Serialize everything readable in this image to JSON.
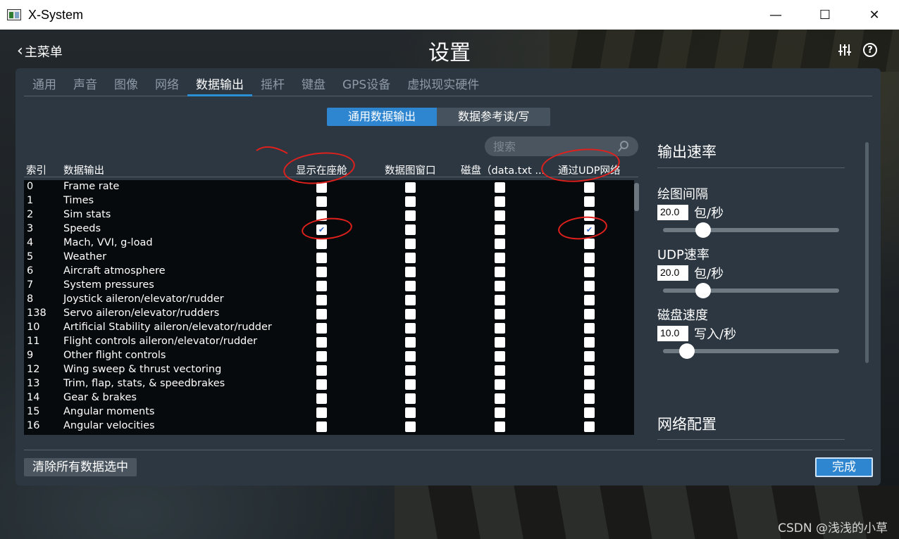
{
  "window": {
    "title": "X-System",
    "minimize": "—",
    "maximize": "☐",
    "close": "✕"
  },
  "header": {
    "back_label": "主菜单",
    "title": "设置"
  },
  "tabs": [
    "通用",
    "声音",
    "图像",
    "网络",
    "数据输出",
    "摇杆",
    "键盘",
    "GPS设备",
    "虚拟现实硬件"
  ],
  "active_tab": "数据输出",
  "segments": [
    "通用数据输出",
    "数据参考读/写"
  ],
  "search": {
    "placeholder": "搜索"
  },
  "columns": {
    "index": "索引",
    "output": "数据输出",
    "cockpit": "显示在座舱",
    "graph": "数据图窗口",
    "disk": "磁盘（data.txt ...",
    "udp": "通过UDP网络"
  },
  "rows": [
    {
      "idx": "0",
      "name": "Frame rate",
      "cockpit": false,
      "graph": false,
      "disk": false,
      "udp": false
    },
    {
      "idx": "1",
      "name": "Times",
      "cockpit": false,
      "graph": false,
      "disk": false,
      "udp": false
    },
    {
      "idx": "2",
      "name": "Sim stats",
      "cockpit": false,
      "graph": false,
      "disk": false,
      "udp": false
    },
    {
      "idx": "3",
      "name": "Speeds",
      "cockpit": true,
      "graph": false,
      "disk": false,
      "udp": true
    },
    {
      "idx": "4",
      "name": "Mach, VVI, g-load",
      "cockpit": false,
      "graph": false,
      "disk": false,
      "udp": false
    },
    {
      "idx": "5",
      "name": "Weather",
      "cockpit": false,
      "graph": false,
      "disk": false,
      "udp": false
    },
    {
      "idx": "6",
      "name": "Aircraft atmosphere",
      "cockpit": false,
      "graph": false,
      "disk": false,
      "udp": false
    },
    {
      "idx": "7",
      "name": "System pressures",
      "cockpit": false,
      "graph": false,
      "disk": false,
      "udp": false
    },
    {
      "idx": "8",
      "name": "Joystick aileron/elevator/rudder",
      "cockpit": false,
      "graph": false,
      "disk": false,
      "udp": false
    },
    {
      "idx": "138",
      "name": "Servo aileron/elevator/rudders",
      "cockpit": false,
      "graph": false,
      "disk": false,
      "udp": false
    },
    {
      "idx": "10",
      "name": "Artificial Stability aileron/elevator/rudder",
      "cockpit": false,
      "graph": false,
      "disk": false,
      "udp": false
    },
    {
      "idx": "11",
      "name": "Flight controls aileron/elevator/rudder",
      "cockpit": false,
      "graph": false,
      "disk": false,
      "udp": false
    },
    {
      "idx": "9",
      "name": "Other flight controls",
      "cockpit": false,
      "graph": false,
      "disk": false,
      "udp": false
    },
    {
      "idx": "12",
      "name": "Wing sweep & thrust vectoring",
      "cockpit": false,
      "graph": false,
      "disk": false,
      "udp": false
    },
    {
      "idx": "13",
      "name": "Trim, flap, stats, & speedbrakes",
      "cockpit": false,
      "graph": false,
      "disk": false,
      "udp": false
    },
    {
      "idx": "14",
      "name": "Gear & brakes",
      "cockpit": false,
      "graph": false,
      "disk": false,
      "udp": false
    },
    {
      "idx": "15",
      "name": "Angular moments",
      "cockpit": false,
      "graph": false,
      "disk": false,
      "udp": false
    },
    {
      "idx": "16",
      "name": "Angular velocities",
      "cockpit": false,
      "graph": false,
      "disk": false,
      "udp": false
    }
  ],
  "right_panel": {
    "rate_title": "输出速率",
    "graph_interval_label": "绘图间隔",
    "graph_interval_value": "20.0",
    "graph_interval_unit": "包/秒",
    "graph_interval_level": 0.2,
    "udp_rate_label": "UDP速率",
    "udp_rate_value": "20.0",
    "udp_rate_unit": "包/秒",
    "udp_rate_level": 0.2,
    "disk_speed_label": "磁盘速度",
    "disk_speed_value": "10.0",
    "disk_speed_unit": "写入/秒",
    "disk_speed_level": 0.1,
    "network_title": "网络配置"
  },
  "footer": {
    "clear_label": "清除所有数据选中",
    "done_label": "完成"
  },
  "watermark": "CSDN @浅浅的小草",
  "colors": {
    "accent": "#2e86d1",
    "panel": "#2c3742",
    "table_bg": "#070a0c",
    "annotation": "#e0201c"
  }
}
